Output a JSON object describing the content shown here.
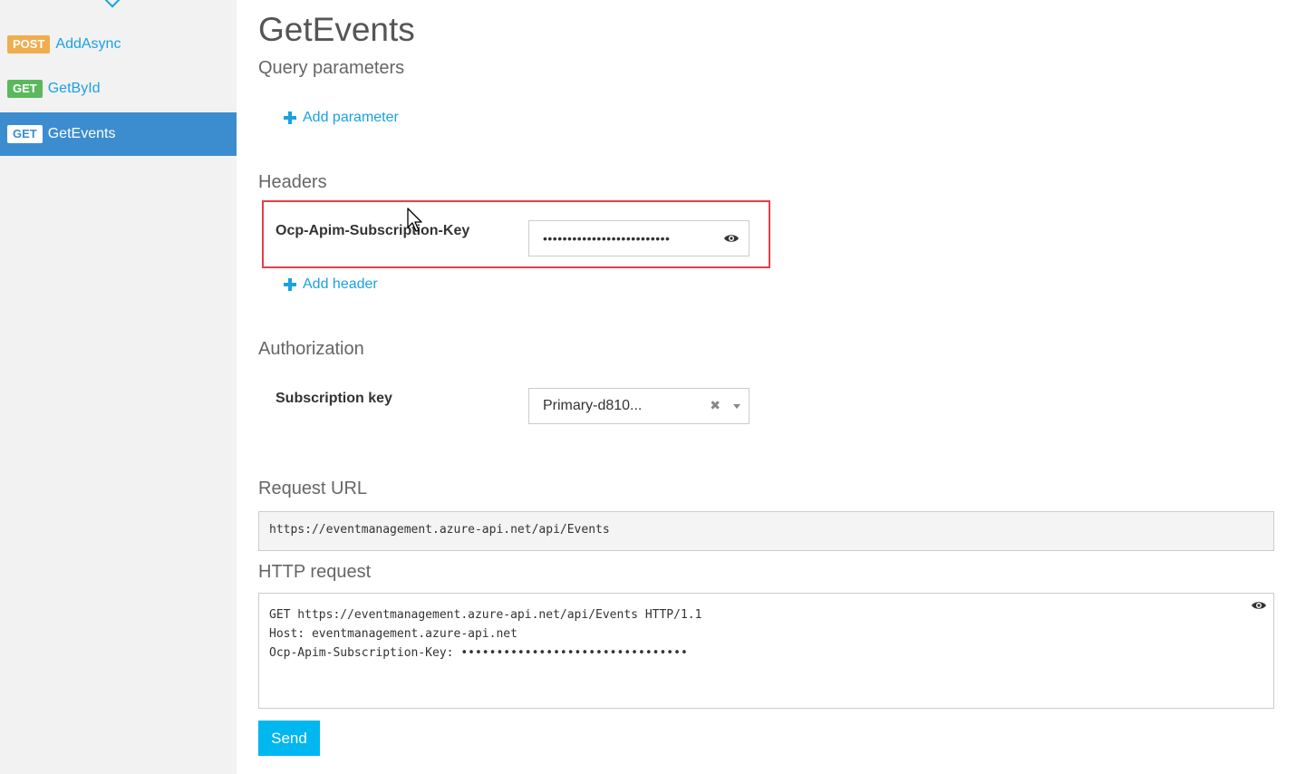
{
  "sidebar": {
    "operations": [
      {
        "method": "POST",
        "name": "AddAsync",
        "active": false
      },
      {
        "method": "GET",
        "name": "GetById",
        "active": false
      },
      {
        "method": "GET",
        "name": "GetEvents",
        "active": true
      }
    ]
  },
  "main": {
    "title": "GetEvents",
    "query_params_title": "Query parameters",
    "add_parameter_label": "Add parameter",
    "headers_title": "Headers",
    "header_key_label": "Ocp-Apim-Subscription-Key",
    "header_key_value": "••••••••••••••••••••••••••",
    "add_header_label": "Add header",
    "authorization_title": "Authorization",
    "subscription_key_label": "Subscription key",
    "subscription_key_selected": "Primary-d810...",
    "request_url_title": "Request URL",
    "request_url": "https://eventmanagement.azure-api.net/api/Events",
    "http_request_title": "HTTP request",
    "http_request_lines": [
      "GET https://eventmanagement.azure-api.net/api/Events HTTP/1.1",
      "Host: eventmanagement.azure-api.net",
      "Ocp-Apim-Subscription-Key: ••••••••••••••••••••••••••••••••"
    ],
    "send_label": "Send"
  },
  "colors": {
    "accent": "#1ba1e2",
    "active_bg": "#3c8dcf",
    "post_badge": "#f0ad4e",
    "get_badge": "#5cb85c",
    "highlight": "#e0414b",
    "send_button": "#00b7f0"
  },
  "icons": {
    "eye": "eye-icon",
    "plus": "plus-icon",
    "clear": "clear-icon",
    "caret": "chevron-down-icon"
  }
}
